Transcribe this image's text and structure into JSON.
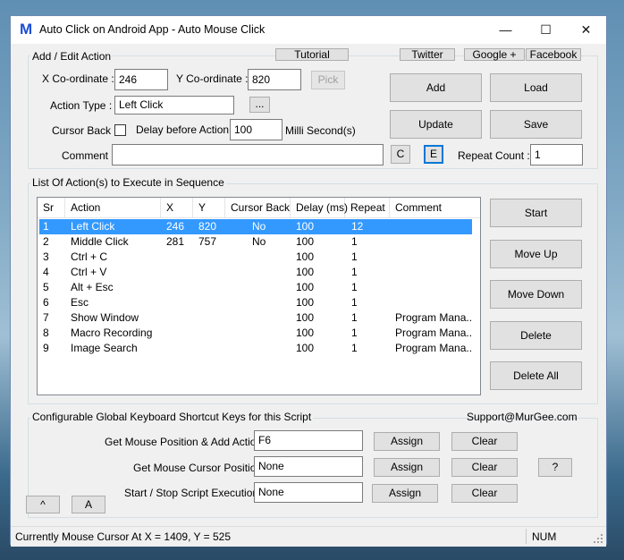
{
  "window": {
    "title": "Auto Click on Android App - Auto Mouse Click",
    "logo_letter": "M",
    "minimize": "—",
    "maximize": "☐",
    "close": "✕"
  },
  "top_links": {
    "tutorial": "Tutorial",
    "twitter": "Twitter",
    "google": "Google +",
    "facebook": "Facebook"
  },
  "add_edit": {
    "legend": "Add / Edit Action",
    "x_label": "X Co-ordinate :",
    "x_value": "246",
    "y_label": "Y Co-ordinate :",
    "y_value": "820",
    "pick": "Pick",
    "action_type_label": "Action Type :",
    "action_type_value": "Left Click",
    "ellipsis": "...",
    "cursor_back_label": "Cursor Back :",
    "delay_label": "Delay before Action :",
    "delay_value": "100",
    "delay_unit": "Milli Second(s)",
    "comment_label": "Comment :",
    "comment_value": "",
    "c_button": "C",
    "e_button": "E",
    "repeat_label": "Repeat Count :",
    "repeat_value": "1",
    "add": "Add",
    "load": "Load",
    "update": "Update",
    "save": "Save"
  },
  "list": {
    "legend": "List Of Action(s) to Execute in Sequence",
    "columns": [
      "Sr",
      "Action",
      "X",
      "Y",
      "Cursor Back",
      "Delay (ms)",
      "Repeat",
      "Comment"
    ],
    "rows": [
      {
        "sr": "1",
        "action": "Left Click",
        "x": "246",
        "y": "820",
        "cursor_back": "No",
        "delay": "100",
        "repeat": "12",
        "comment": ""
      },
      {
        "sr": "2",
        "action": "Middle Click",
        "x": "281",
        "y": "757",
        "cursor_back": "No",
        "delay": "100",
        "repeat": "1",
        "comment": ""
      },
      {
        "sr": "3",
        "action": "Ctrl + C",
        "x": "",
        "y": "",
        "cursor_back": "",
        "delay": "100",
        "repeat": "1",
        "comment": ""
      },
      {
        "sr": "4",
        "action": "Ctrl + V",
        "x": "",
        "y": "",
        "cursor_back": "",
        "delay": "100",
        "repeat": "1",
        "comment": ""
      },
      {
        "sr": "5",
        "action": "Alt + Esc",
        "x": "",
        "y": "",
        "cursor_back": "",
        "delay": "100",
        "repeat": "1",
        "comment": ""
      },
      {
        "sr": "6",
        "action": "Esc",
        "x": "",
        "y": "",
        "cursor_back": "",
        "delay": "100",
        "repeat": "1",
        "comment": ""
      },
      {
        "sr": "7",
        "action": "Show Window",
        "x": "",
        "y": "",
        "cursor_back": "",
        "delay": "100",
        "repeat": "1",
        "comment": "Program Mana..."
      },
      {
        "sr": "8",
        "action": "Macro Recording",
        "x": "",
        "y": "",
        "cursor_back": "",
        "delay": "100",
        "repeat": "1",
        "comment": "Program Mana..."
      },
      {
        "sr": "9",
        "action": "Image Search",
        "x": "",
        "y": "",
        "cursor_back": "",
        "delay": "100",
        "repeat": "1",
        "comment": "Program Mana..."
      }
    ],
    "start": "Start",
    "move_up": "Move Up",
    "move_down": "Move Down",
    "delete": "Delete",
    "delete_all": "Delete All"
  },
  "shortcuts": {
    "legend": "Configurable Global Keyboard Shortcut Keys for this Script",
    "support": "Support@MurGee.com",
    "get_pos_label": "Get Mouse Position & Add Action :",
    "get_pos_value": "F6",
    "get_cursor_label": "Get Mouse Cursor Position :",
    "get_cursor_value": "None",
    "start_stop_label": "Start / Stop Script Execution :",
    "start_stop_value": "None",
    "assign": "Assign",
    "clear": "Clear",
    "help": "?",
    "caret": "^",
    "a_button": "A"
  },
  "status": {
    "text": "Currently Mouse Cursor At X = 1409, Y = 525",
    "num": "NUM"
  }
}
